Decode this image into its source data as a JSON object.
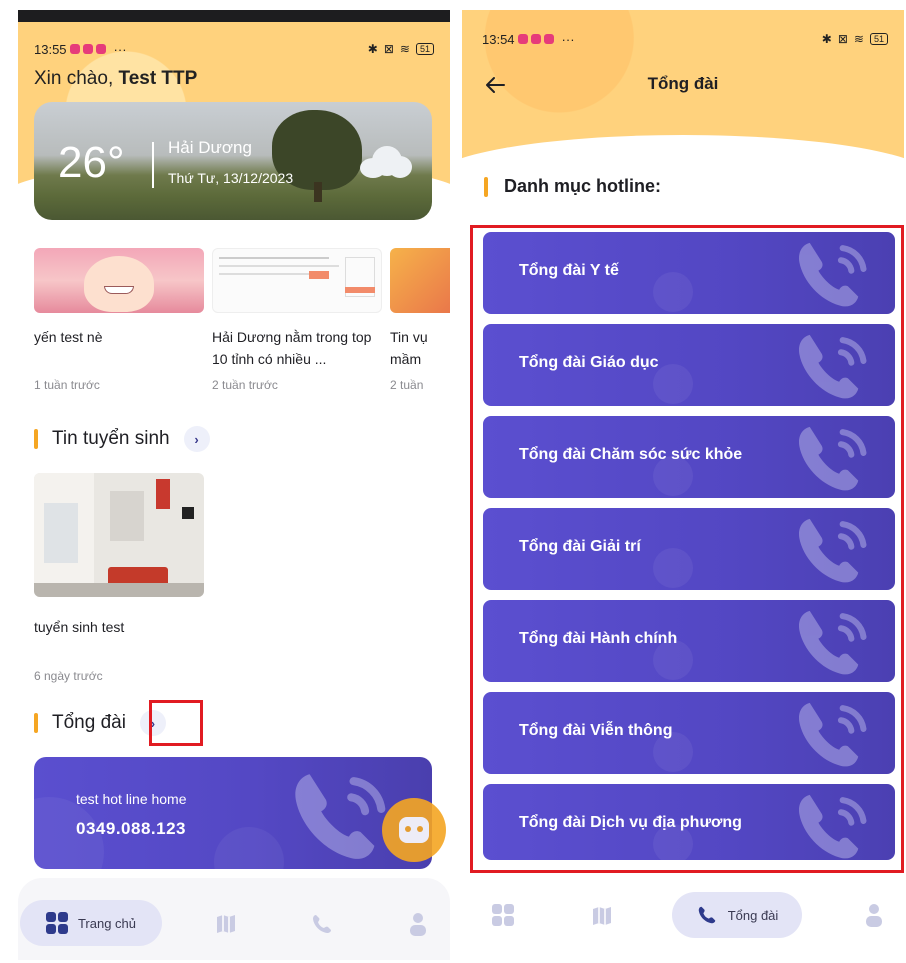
{
  "left": {
    "status": {
      "time": "13:55",
      "dots": "···",
      "battery": "51"
    },
    "greeting": {
      "prefix": "Xin chào, ",
      "name": "Test TTP"
    },
    "weather": {
      "temp": "26°",
      "city": "Hải Dương",
      "date": "Thứ Tư, 13/12/2023"
    },
    "news": [
      {
        "title": "yến test nè",
        "time": "1 tuần trước"
      },
      {
        "title": "Hải Dương nằm trong top 10 tỉnh có nhiều ...",
        "time": "2 tuần trước"
      },
      {
        "title": "Tin vụ mầm",
        "time": "2 tuần"
      }
    ],
    "admissions": {
      "title": "Tin tuyển sinh",
      "chevron": "›",
      "item_title": "tuyển sinh test",
      "item_time": "6 ngày trước"
    },
    "switchboard": {
      "title": "Tổng đài",
      "chevron": "›",
      "card_label": "test hot line home",
      "card_number": "0349.088.123"
    },
    "nav": {
      "home_label": "Trang chủ"
    }
  },
  "right": {
    "status": {
      "time": "13:54",
      "dots": "···",
      "battery": "51"
    },
    "title": "Tổng đài",
    "list_title": "Danh mục hotline:",
    "items": [
      "Tổng đài Y tế",
      "Tổng đài Giáo dục",
      "Tổng đài Chăm sóc sức khỏe",
      "Tổng đài Giải trí",
      "Tổng đài Hành chính",
      "Tổng đài Viễn thông",
      "Tổng đài Dịch vụ địa phương"
    ],
    "nav": {
      "active_label": "Tổng đài"
    }
  },
  "colors": {
    "header_yellow": "#ffd27d",
    "accent_orange": "#f5a623",
    "card_purple": "#5448c4",
    "highlight_red": "#e11b22"
  },
  "icons": [
    "arrow-left-icon",
    "bluetooth-icon",
    "wifi-icon",
    "battery-icon",
    "phone-icon",
    "map-icon",
    "user-icon",
    "grid-icon",
    "chevron-right-icon",
    "chatbot-icon",
    "cloud-icon"
  ]
}
